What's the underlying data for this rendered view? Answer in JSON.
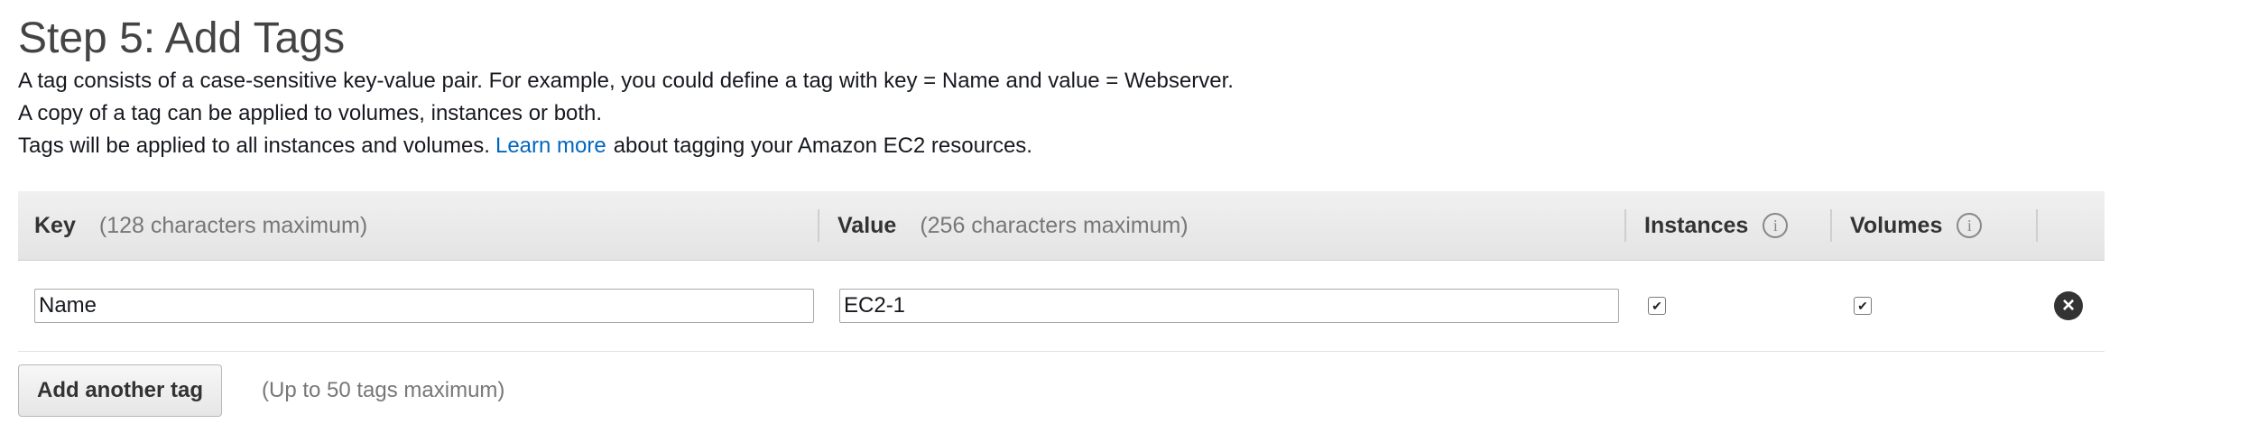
{
  "header": {
    "title": "Step 5: Add Tags",
    "line1": "A tag consists of a case-sensitive key-value pair. For example, you could define a tag with key = Name and value = Webserver.",
    "line2": "A copy of a tag can be applied to volumes, instances or both.",
    "line3_before": "Tags will be applied to all instances and volumes.",
    "learn_more": "Learn more",
    "line3_after": "about tagging your Amazon EC2 resources."
  },
  "table": {
    "columns": {
      "key_label": "Key",
      "key_hint": "(128 characters maximum)",
      "value_label": "Value",
      "value_hint": "(256 characters maximum)",
      "instances_label": "Instances",
      "volumes_label": "Volumes",
      "info_icon": "info-icon"
    },
    "rows": [
      {
        "key": "Name",
        "value": "EC2-1",
        "instances_checked": true,
        "volumes_checked": true,
        "remove_icon": "close-circle-icon"
      }
    ]
  },
  "actions": {
    "add_tag_label": "Add another tag",
    "add_tag_hint": "(Up to 50 tags maximum)"
  }
}
